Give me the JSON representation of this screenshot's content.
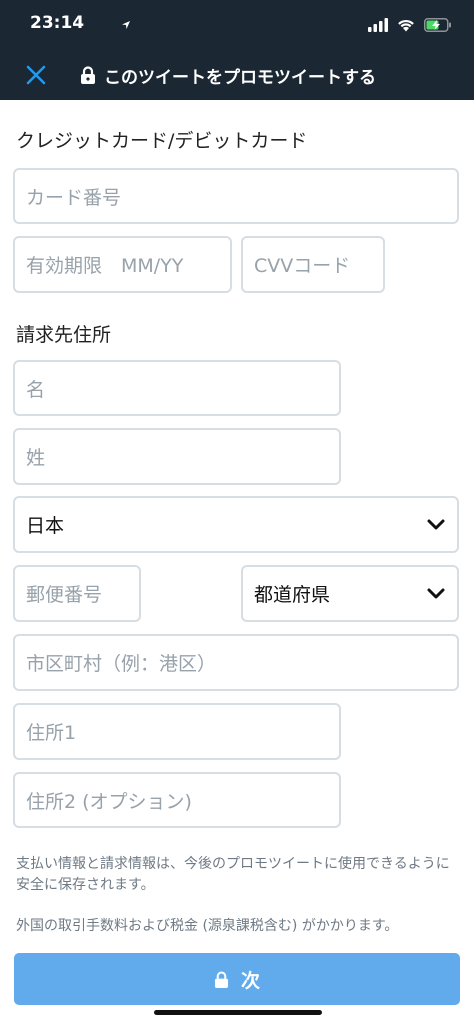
{
  "status_bar": {
    "time": "23:14"
  },
  "header": {
    "title": "このツイートをプロモツイートする"
  },
  "card": {
    "section_title": "クレジットカード/デビットカード",
    "number_placeholder": "カード番号",
    "expiry_placeholder": "有効期限　MM/YY",
    "cvv_placeholder": "CVVコード"
  },
  "billing": {
    "section_title": "請求先住所",
    "first_name_placeholder": "名",
    "last_name_placeholder": "姓",
    "country_value": "日本",
    "postal_placeholder": "郵便番号",
    "prefecture_value": "都道府県",
    "city_placeholder": "市区町村（例：港区）",
    "address1_placeholder": "住所1",
    "address2_placeholder": "住所2 (オプション)"
  },
  "notes": {
    "storage": "支払い情報と請求情報は、今後のプロモツイートに使用できるように安全に保存されます。",
    "fees": "外国の取引手数料および税金 (源泉課税含む) がかかります。"
  },
  "next_button": {
    "label": "次"
  },
  "colors": {
    "header_bg": "#1b2733",
    "accent": "#1d9bf0",
    "button_bg": "#61aaeb"
  }
}
